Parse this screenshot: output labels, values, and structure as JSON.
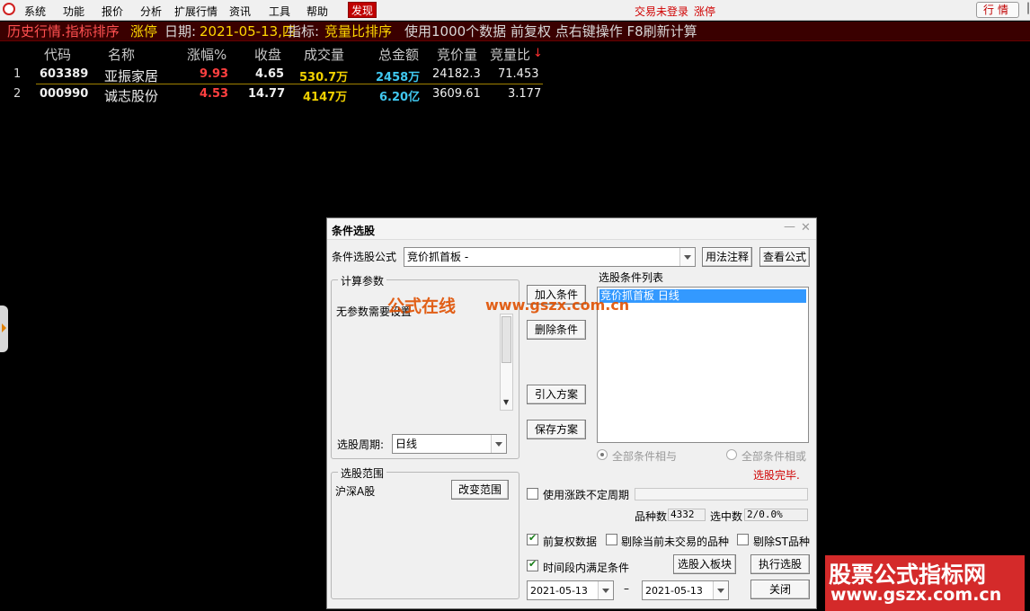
{
  "menubar": {
    "items": [
      "系统",
      "功能",
      "报价",
      "分析",
      "扩展行情",
      "资讯",
      "工具",
      "帮助",
      "发现"
    ],
    "status_login": "交易未登录",
    "status_mode": "涨停",
    "hq_button": "行情"
  },
  "infobar": {
    "part1": "历史行情.指标排序",
    "part2": "涨停",
    "part3": "日期:",
    "part4": "2021-05-13,四",
    "part5": "指标:",
    "part6": "竞量比排序",
    "part7": "使用1000个数据 前复权 点右键操作 F8刷新计算"
  },
  "table": {
    "headers": [
      "代码",
      "名称",
      "涨幅%",
      "收盘",
      "成交量",
      "总金额",
      "竞价量",
      "竞量比"
    ],
    "sort_indicator": "↓",
    "rows": [
      {
        "num": "1",
        "code": "603389",
        "name": "亚振家居",
        "pct": "9.93",
        "close": "4.65",
        "volume": "530.7万",
        "amount": "2458万",
        "bid_vol": "24182.3",
        "ratio": "71.453"
      },
      {
        "num": "2",
        "code": "000990",
        "name": "诚志股份",
        "pct": "4.53",
        "close": "14.77",
        "volume": "4147万",
        "amount": "6.20亿",
        "bid_vol": "3609.61",
        "ratio": "3.177"
      }
    ]
  },
  "dialog": {
    "title": "条件选股",
    "formula_label": "条件选股公式",
    "formula_value": "竞价抓首板    -",
    "usage_button": "用法注释",
    "view_button": "查看公式",
    "params_group": "计算参数",
    "params_text": "无参数需要设置",
    "period_label": "选股周期:",
    "period_value": "日线",
    "add_button": "加入条件",
    "delete_button": "删除条件",
    "import_button": "引入方案",
    "save_button": "保存方案",
    "list_label": "选股条件列表",
    "list_items": [
      "竞价抓首板   日线"
    ],
    "radio_and": "全部条件相与",
    "radio_or": "全部条件相或",
    "complete_text": "选股完毕.",
    "scope_group": "选股范围",
    "scope_value": "沪深A股",
    "change_scope_button": "改变范围",
    "uncertain_period_label": "使用涨跌不定周期",
    "count_label": "品种数",
    "count_value": "4332",
    "selected_label": "选中数",
    "selected_value": "2/0.0%",
    "restore_label": "前复权数据",
    "exclude_not_trading_label": "剔除当前未交易的品种",
    "exclude_st_label": "剔除ST品种",
    "time_range_label": "时间段内满足条件",
    "to_board_button": "选股入板块",
    "run_button": "执行选股",
    "date_from": "2021-05-13",
    "date_sep": "–",
    "date_to": "2021-05-13",
    "close_button": "关闭"
  },
  "watermarks": {
    "site_cn": "公式在线",
    "site_url": "www.gszx.com.cn",
    "brand_title": "股票公式指标网",
    "brand_url": "www.gszx.com.cn"
  },
  "colors": {
    "up_red": "#ff4040",
    "volume_yellow": "#f0d000",
    "amount_cyan": "#40c8f0",
    "selection_blue": "#3399ff"
  }
}
